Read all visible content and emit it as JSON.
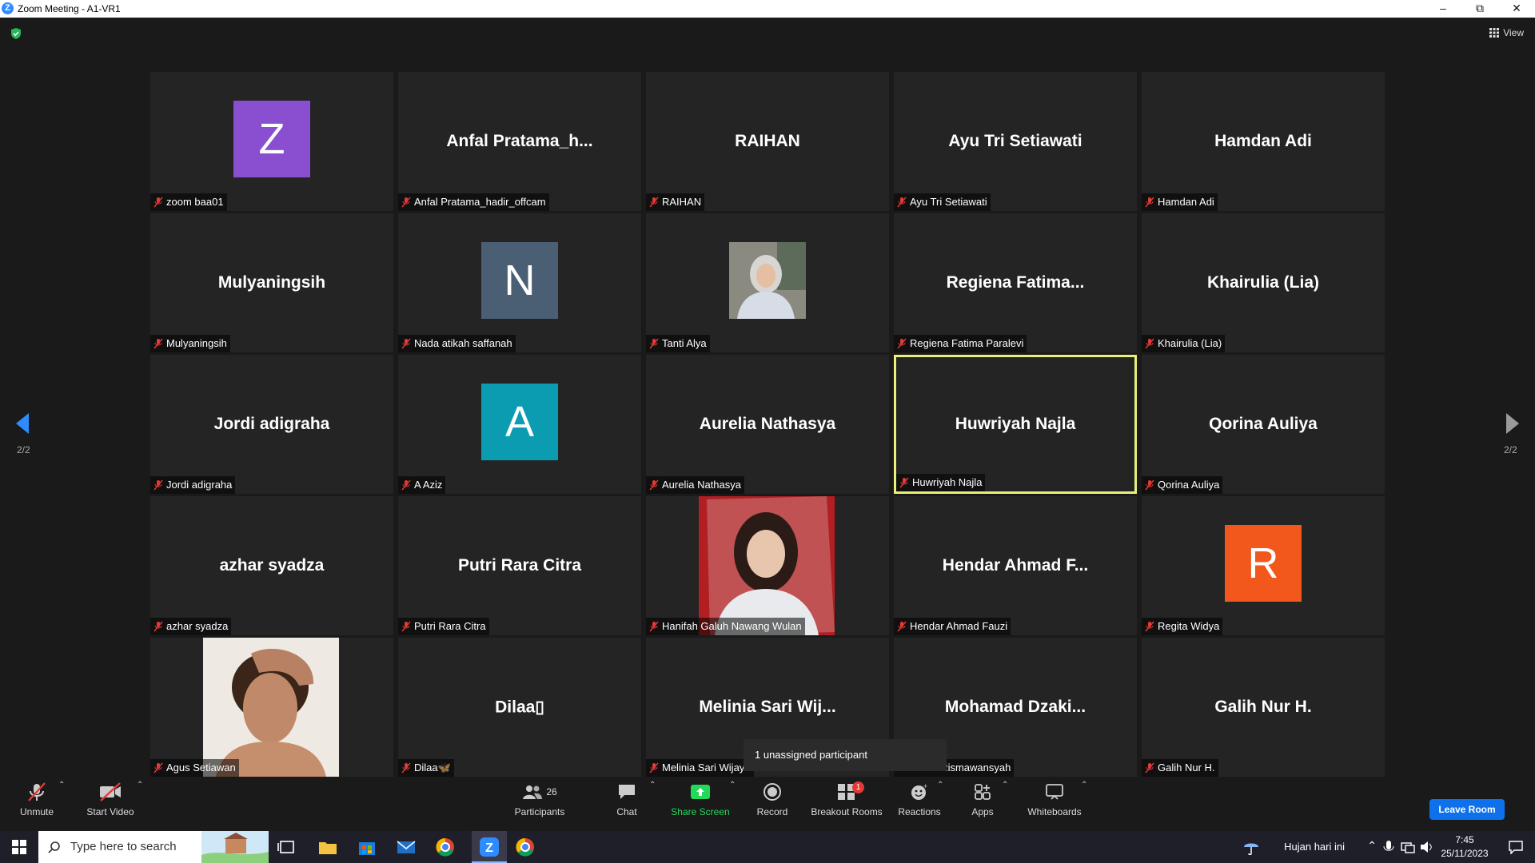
{
  "window": {
    "title": "Zoom Meeting - A1-VR1",
    "app_icon": "zoom-logo"
  },
  "topbar": {
    "view_label": "View",
    "security_icon": "shield-check-icon"
  },
  "pagination": {
    "left_label": "2/2",
    "right_label": "2/2"
  },
  "tiles": [
    {
      "display": "Z",
      "name": "zoom baa01",
      "avatar_color": "#8a4fd1"
    },
    {
      "display": "Anfal  Pratama_h...",
      "name": "Anfal Pratama_hadir_offcam"
    },
    {
      "display": "RAIHAN",
      "name": "RAIHAN"
    },
    {
      "display": "Ayu Tri Setiawati",
      "name": "Ayu Tri Setiawati"
    },
    {
      "display": "Hamdan Adi",
      "name": "Hamdan Adi"
    },
    {
      "display": "Mulyaningsih",
      "name": "Mulyaningsih"
    },
    {
      "display": "N",
      "name": "Nada atikah saffanah",
      "avatar_color": "#4a5f73"
    },
    {
      "display": "",
      "name": "Tanti Alya"
    },
    {
      "display": "Regiena  Fatima...",
      "name": "Regiena Fatima Paralevi"
    },
    {
      "display": "Khairulia (Lia)",
      "name": "Khairulia (Lia)"
    },
    {
      "display": "Jordi adigraha",
      "name": "Jordi adigraha"
    },
    {
      "display": "A",
      "name": "A Aziz",
      "avatar_color": "#0c9cb2"
    },
    {
      "display": "Aurelia Nathasya",
      "name": "Aurelia Nathasya"
    },
    {
      "display": "Huwriyah Najla",
      "name": "Huwriyah Najla"
    },
    {
      "display": "Qorina Auliya",
      "name": "Qorina Auliya"
    },
    {
      "display": "azhar syadza",
      "name": "azhar syadza"
    },
    {
      "display": "Putri Rara Citra",
      "name": "Putri Rara Citra"
    },
    {
      "display": "",
      "name": "Hanifah Galuh Nawang Wulan"
    },
    {
      "display": "Hendar Ahmad  F...",
      "name": "Hendar Ahmad Fauzi"
    },
    {
      "display": "R",
      "name": "Regita Widya",
      "avatar_color": "#f2571c"
    },
    {
      "display": "",
      "name": "Agus Setiawan"
    },
    {
      "display": "Dilaa▯",
      "name": "Dilaa🦋"
    },
    {
      "display": "Melinia Sari Wij...",
      "name": "Melinia Sari Wijaya"
    },
    {
      "display": "Mohamad  Dzaki...",
      "name": "ad Dzaki Rismawansyah"
    },
    {
      "display": "Galih Nur H.",
      "name": "Galih Nur H."
    }
  ],
  "toast": {
    "text": "1 unassigned participant"
  },
  "toolbar": {
    "unmute": "Unmute",
    "start_video": "Start Video",
    "participants": "Participants",
    "participants_count": "26",
    "chat": "Chat",
    "share_screen": "Share Screen",
    "record": "Record",
    "breakout_rooms": "Breakout Rooms",
    "breakout_badge": "1",
    "reactions": "Reactions",
    "apps": "Apps",
    "whiteboards": "Whiteboards",
    "leave": "Leave Room",
    "share_color": "#23d959",
    "leave_color": "#0e71eb"
  },
  "taskbar": {
    "search_placeholder": "Type here to search",
    "weather": "Hujan hari ini",
    "time": "7:45",
    "date": "25/11/2023"
  }
}
